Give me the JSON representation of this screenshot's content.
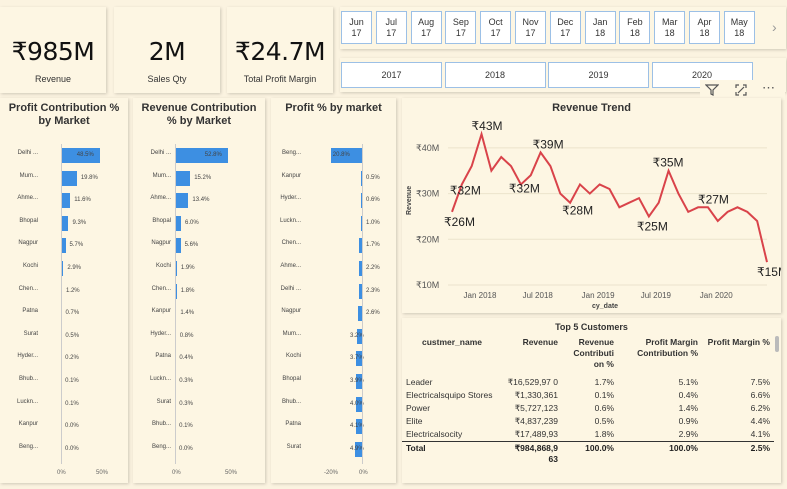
{
  "kpis": [
    {
      "value": "₹985M",
      "label": "Revenue"
    },
    {
      "value": "2M",
      "label": "Sales Qty"
    },
    {
      "value": "₹24.7M",
      "label": "Total Profit Margin"
    }
  ],
  "month_slicer": {
    "items": [
      {
        "m": "Jun",
        "y": "17"
      },
      {
        "m": "Jul",
        "y": "17"
      },
      {
        "m": "Aug",
        "y": "17"
      },
      {
        "m": "Sep",
        "y": "17"
      },
      {
        "m": "Oct",
        "y": "17"
      },
      {
        "m": "Nov",
        "y": "17"
      },
      {
        "m": "Dec",
        "y": "17"
      },
      {
        "m": "Jan",
        "y": "18"
      },
      {
        "m": "Feb",
        "y": "18"
      },
      {
        "m": "Mar",
        "y": "18"
      },
      {
        "m": "Apr",
        "y": "18"
      },
      {
        "m": "May",
        "y": "18"
      }
    ],
    "next_arrow": "›"
  },
  "year_slicer": {
    "items": [
      "2017",
      "2018",
      "2019",
      "2020"
    ]
  },
  "visual_toolbar": {
    "filter": "filter-icon",
    "focus": "focus-mode-icon",
    "more": "⋯"
  },
  "profit_contribution": {
    "title": "Profit Contribution % by Market",
    "ticks": [
      "0%",
      "50%"
    ],
    "rows": [
      {
        "label": "Delhi ...",
        "value": 48.5,
        "text": "48.5%"
      },
      {
        "label": "Mum...",
        "value": 19.8,
        "text": "19.8%"
      },
      {
        "label": "Ahme...",
        "value": 11.6,
        "text": "11.6%"
      },
      {
        "label": "Bhopal",
        "value": 9.3,
        "text": "9.3%"
      },
      {
        "label": "Nagpur",
        "value": 5.7,
        "text": "5.7%"
      },
      {
        "label": "Kochi",
        "value": 2.9,
        "text": "2.9%"
      },
      {
        "label": "Chen...",
        "value": 1.2,
        "text": "1.2%"
      },
      {
        "label": "Patna",
        "value": 0.7,
        "text": "0.7%"
      },
      {
        "label": "Surat",
        "value": 0.5,
        "text": "0.5%"
      },
      {
        "label": "Hyder...",
        "value": 0.2,
        "text": "0.2%"
      },
      {
        "label": "Bhub...",
        "value": 0.1,
        "text": "0.1%"
      },
      {
        "label": "Luckn...",
        "value": 0.1,
        "text": "0.1%"
      },
      {
        "label": "Kanpur",
        "value": 0.0,
        "text": "0.0%"
      },
      {
        "label": "Beng...",
        "value": 0.0,
        "text": "0.0%"
      }
    ]
  },
  "revenue_contribution": {
    "title": "Revenue Contribution % by Market",
    "ticks": [
      "0%",
      "50%"
    ],
    "rows": [
      {
        "label": "Delhi ...",
        "value": 52.8,
        "text": "52.8%"
      },
      {
        "label": "Mum...",
        "value": 15.2,
        "text": "15.2%"
      },
      {
        "label": "Ahme...",
        "value": 13.4,
        "text": "13.4%"
      },
      {
        "label": "Bhopal",
        "value": 6.0,
        "text": "6.0%"
      },
      {
        "label": "Nagpur",
        "value": 5.6,
        "text": "5.6%"
      },
      {
        "label": "Kochi",
        "value": 1.9,
        "text": "1.9%"
      },
      {
        "label": "Chen...",
        "value": 1.8,
        "text": "1.8%"
      },
      {
        "label": "Kanpur",
        "value": 1.4,
        "text": "1.4%"
      },
      {
        "label": "Hyder...",
        "value": 0.8,
        "text": "0.8%"
      },
      {
        "label": "Patna",
        "value": 0.4,
        "text": "0.4%"
      },
      {
        "label": "Luckn...",
        "value": 0.3,
        "text": "0.3%"
      },
      {
        "label": "Surat",
        "value": 0.3,
        "text": "0.3%"
      },
      {
        "label": "Bhub...",
        "value": 0.1,
        "text": "0.1%"
      },
      {
        "label": "Beng...",
        "value": 0.0,
        "text": "0.0%"
      }
    ]
  },
  "profit_pct": {
    "title": "Profit % by market",
    "ticks": [
      "-20%",
      "0%"
    ],
    "rows": [
      {
        "label": "Beng...",
        "value": 20.8,
        "text": "20.8%"
      },
      {
        "label": "Kanpur",
        "value": 0.5,
        "text": "0.5%"
      },
      {
        "label": "Hyder...",
        "value": 0.6,
        "text": "0.6%"
      },
      {
        "label": "Luckn...",
        "value": 1.0,
        "text": "1.0%"
      },
      {
        "label": "Chen...",
        "value": 1.7,
        "text": "1.7%"
      },
      {
        "label": "Ahme...",
        "value": 2.2,
        "text": "2.2%"
      },
      {
        "label": "Delhi ...",
        "value": 2.3,
        "text": "2.3%"
      },
      {
        "label": "Nagpur",
        "value": 2.6,
        "text": "2.6%"
      },
      {
        "label": "Mum...",
        "value": 3.2,
        "text": "3.2%"
      },
      {
        "label": "Kochi",
        "value": 3.7,
        "text": "3.7%"
      },
      {
        "label": "Bhopal",
        "value": 3.9,
        "text": "3.9%"
      },
      {
        "label": "Bhub...",
        "value": 4.0,
        "text": "4.0%"
      },
      {
        "label": "Patna",
        "value": 4.1,
        "text": "4.1%"
      },
      {
        "label": "Surat",
        "value": 4.9,
        "text": "4.9%"
      }
    ]
  },
  "revenue_trend": {
    "title": "Revenue Trend",
    "ylabel": "Revenue",
    "xlabel": "cy_date",
    "yticks": [
      "₹40M",
      "₹30M",
      "₹20M",
      "₹10M"
    ],
    "xticks": [
      "Jan 2018",
      "Jul 2018",
      "Jan 2019",
      "Jul 2019",
      "Jan 2020"
    ],
    "data_labels": [
      "₹26M",
      "₹32M",
      "₹43M",
      "₹32M",
      "₹39M",
      "₹28M",
      "₹35M",
      "₹25M",
      "₹27M",
      "₹15M"
    ]
  },
  "chart_data": {
    "type": "line",
    "title": "Revenue Trend",
    "xlabel": "cy_date",
    "ylabel": "Revenue",
    "ylim": [
      10,
      45
    ],
    "unit": "₹M",
    "x": [
      "2017-10",
      "2017-11",
      "2017-12",
      "2018-01",
      "2018-02",
      "2018-03",
      "2018-04",
      "2018-05",
      "2018-06",
      "2018-07",
      "2018-08",
      "2018-09",
      "2018-10",
      "2018-11",
      "2018-12",
      "2019-01",
      "2019-02",
      "2019-03",
      "2019-04",
      "2019-05",
      "2019-06",
      "2019-07",
      "2019-08",
      "2019-09",
      "2019-10",
      "2019-11",
      "2019-12",
      "2020-01",
      "2020-02",
      "2020-03",
      "2020-04",
      "2020-05",
      "2020-06"
    ],
    "values": [
      26,
      32,
      36,
      43,
      35,
      38,
      36,
      32,
      34,
      39,
      36,
      30,
      28,
      32,
      30,
      32,
      31,
      27,
      28,
      29,
      25,
      28,
      35,
      30,
      26,
      27,
      27,
      24,
      26,
      27,
      26,
      24,
      15
    ]
  },
  "top_customers": {
    "title": "Top 5 Customers",
    "columns": [
      "custmer_name",
      "Revenue",
      "Revenue Contributi on %",
      "Profit Margin Contribution %",
      "Profit Margin %"
    ],
    "rows": [
      [
        "Leader",
        "₹16,529,97 0",
        "1.7%",
        "5.1%",
        "7.5%"
      ],
      [
        "Electricalsquipo Stores",
        "₹1,330,361",
        "0.1%",
        "0.4%",
        "6.6%"
      ],
      [
        "Power",
        "₹5,727,123",
        "0.6%",
        "1.4%",
        "6.2%"
      ],
      [
        "Elite",
        "₹4,837,239",
        "0.5%",
        "0.9%",
        "4.4%"
      ],
      [
        "Electricalsocity",
        "₹17,489,93",
        "1.8%",
        "2.9%",
        "4.1%"
      ]
    ],
    "total": [
      "Total",
      "₹984,868,9 63",
      "100.0%",
      "100.0%",
      "2.5%"
    ]
  }
}
